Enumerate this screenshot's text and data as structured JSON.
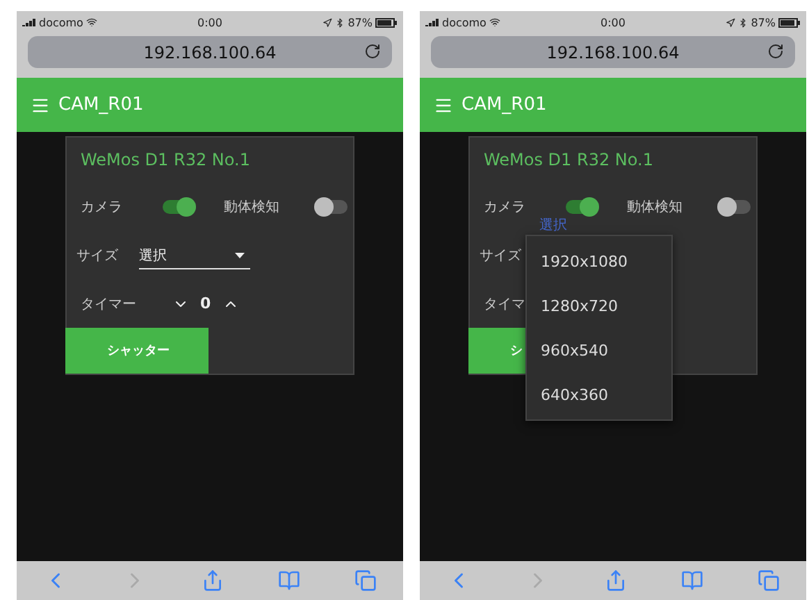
{
  "screens": [
    {
      "status": {
        "carrier": "docomo",
        "time": "0:00",
        "battery": "87%"
      },
      "url": "192.168.100.64",
      "app_title": "CAM_R01",
      "card": {
        "title": "WeMos D1 R32 No.1",
        "toggles": [
          {
            "label": "カメラ",
            "on": true
          },
          {
            "label": "動体検知",
            "on": false
          }
        ],
        "size": {
          "label": "サイズ",
          "value": "選択"
        },
        "timer": {
          "label": "タイマー",
          "value": "0"
        },
        "shutter": "シャッター"
      },
      "toolbar": {
        "back_disabled": false,
        "forward_disabled": true
      }
    },
    {
      "status": {
        "carrier": "docomo",
        "time": "0:00",
        "battery": "87%"
      },
      "url": "192.168.100.64",
      "app_title": "CAM_R01",
      "card": {
        "title": "WeMos D1 R32 No.1",
        "toggles": [
          {
            "label": "カメラ",
            "on": true
          },
          {
            "label": "動体検知",
            "on": false
          }
        ],
        "size": {
          "label": "サイズ",
          "floating_label": "選択"
        },
        "timer": {
          "label": "タイマ"
        },
        "shutter": "シ"
      },
      "menu": {
        "options": [
          "1920x1080",
          "1280x720",
          "960x540",
          "640x360"
        ]
      },
      "toolbar": {
        "back_disabled": false,
        "forward_disabled": true
      }
    }
  ]
}
